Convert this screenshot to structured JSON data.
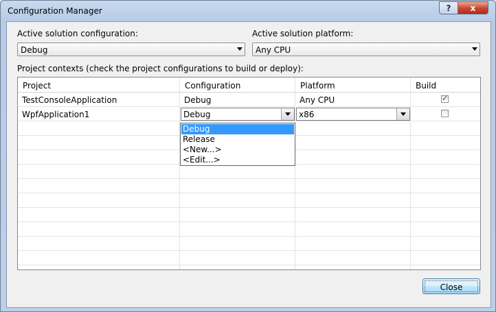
{
  "window": {
    "title": "Configuration Manager",
    "help_glyph": "?",
    "close_glyph": "x"
  },
  "solution": {
    "config_label": "Active solution configuration:",
    "config_value": "Debug",
    "platform_label": "Active solution platform:",
    "platform_value": "Any CPU"
  },
  "contexts": {
    "label": "Project contexts (check the project configurations to build or deploy):",
    "columns": [
      "Project",
      "Configuration",
      "Platform",
      "Build"
    ],
    "rows": [
      {
        "project": "TestConsoleApplication",
        "configuration": "Debug",
        "platform": "Any CPU",
        "build": true
      },
      {
        "project": "WpfApplication1",
        "configuration": "Debug",
        "platform": "x86",
        "build": false
      }
    ]
  },
  "dropdown": {
    "options": [
      "Debug",
      "Release",
      "<New...>",
      "<Edit...>"
    ],
    "selected_index": 0
  },
  "buttons": {
    "close_label": "Close"
  },
  "colors": {
    "selection": "#3399ff",
    "accent": "#3c7fb1"
  }
}
